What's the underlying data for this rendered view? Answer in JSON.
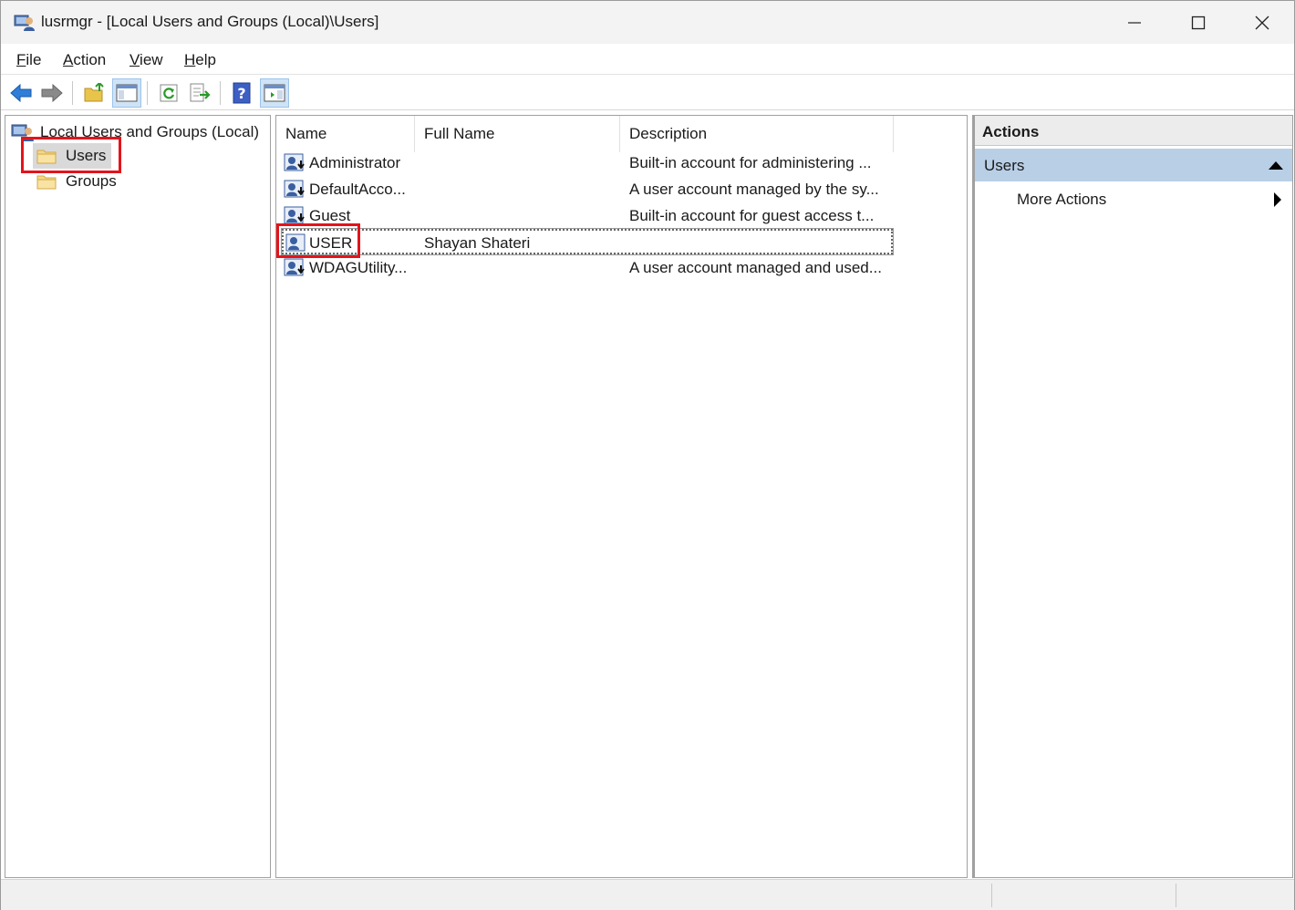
{
  "window": {
    "title": "lusrmgr - [Local Users and Groups (Local)\\Users]",
    "controls": [
      "minimize",
      "maximize",
      "close"
    ]
  },
  "menubar": {
    "items": [
      "File",
      "Action",
      "View",
      "Help"
    ]
  },
  "toolbar": {
    "buttons": [
      "back-arrow-icon",
      "forward-arrow-icon",
      "up-folder-icon",
      "show-hide-console-tree-icon",
      "refresh-icon",
      "export-list-icon",
      "help-icon",
      "show-hide-action-pane-icon"
    ]
  },
  "tree": {
    "root": "Local Users and Groups (Local)",
    "children": [
      {
        "label": "Users",
        "selected": true
      },
      {
        "label": "Groups",
        "selected": false
      }
    ]
  },
  "list": {
    "columns": [
      "Name",
      "Full Name",
      "Description"
    ],
    "rows": [
      {
        "name": "Administrator",
        "full_name": "",
        "description": "Built-in account for administering ..."
      },
      {
        "name": "DefaultAcco...",
        "full_name": "",
        "description": "A user account managed by the sy..."
      },
      {
        "name": "Guest",
        "full_name": "",
        "description": "Built-in account for guest access t..."
      },
      {
        "name": "USER",
        "full_name": "Shayan Shateri",
        "description": ""
      },
      {
        "name": "WDAGUtility...",
        "full_name": "",
        "description": "A user account managed and used..."
      }
    ]
  },
  "actions": {
    "title": "Actions",
    "section": "Users",
    "items": [
      "More Actions"
    ]
  },
  "colors": {
    "highlight_red": "#e3141b",
    "actions_section_bg": "#b9cfe6",
    "selected_node_bg": "#d9d9d9"
  }
}
